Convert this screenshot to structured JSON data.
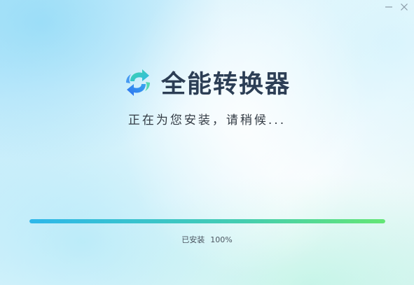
{
  "app": {
    "name": "全能转换器"
  },
  "window_controls": {
    "minimize_icon": "minimize-icon",
    "close_icon": "close-icon"
  },
  "status": {
    "message": "正在为您安装，请稍候..."
  },
  "progress": {
    "label": "已安装",
    "percent_text": "100%",
    "fraction": 1.0
  },
  "colors": {
    "progress_start": "#2db7ea",
    "progress_end": "#63e675",
    "title_text": "#2c3e55",
    "logo_blue": "#2f8cf0",
    "logo_green": "#3ed6a4"
  }
}
